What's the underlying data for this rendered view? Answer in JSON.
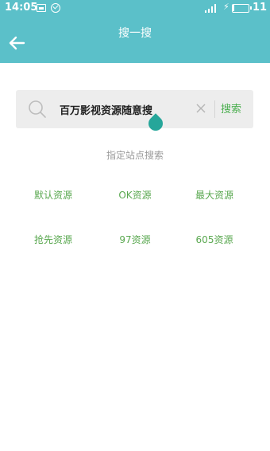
{
  "status_bar": {
    "time": "14:05",
    "battery_level": "11",
    "battery_fraction": 0.11
  },
  "header": {
    "title": "搜一搜",
    "back_icon": "arrow-left-icon"
  },
  "search": {
    "value": "百万影视资源随意搜",
    "button_label": "搜索",
    "icons": [
      "search-icon",
      "clear-icon"
    ]
  },
  "site_hint": "指定站点搜索",
  "sources": [
    "默认资源",
    "OK资源",
    "最大资源",
    "抢先资源",
    "97资源",
    "605资源"
  ],
  "colors": {
    "header_bg": "#5bc0c9",
    "accent_green": "#5aa850",
    "cursor_handle": "#26a69a"
  }
}
